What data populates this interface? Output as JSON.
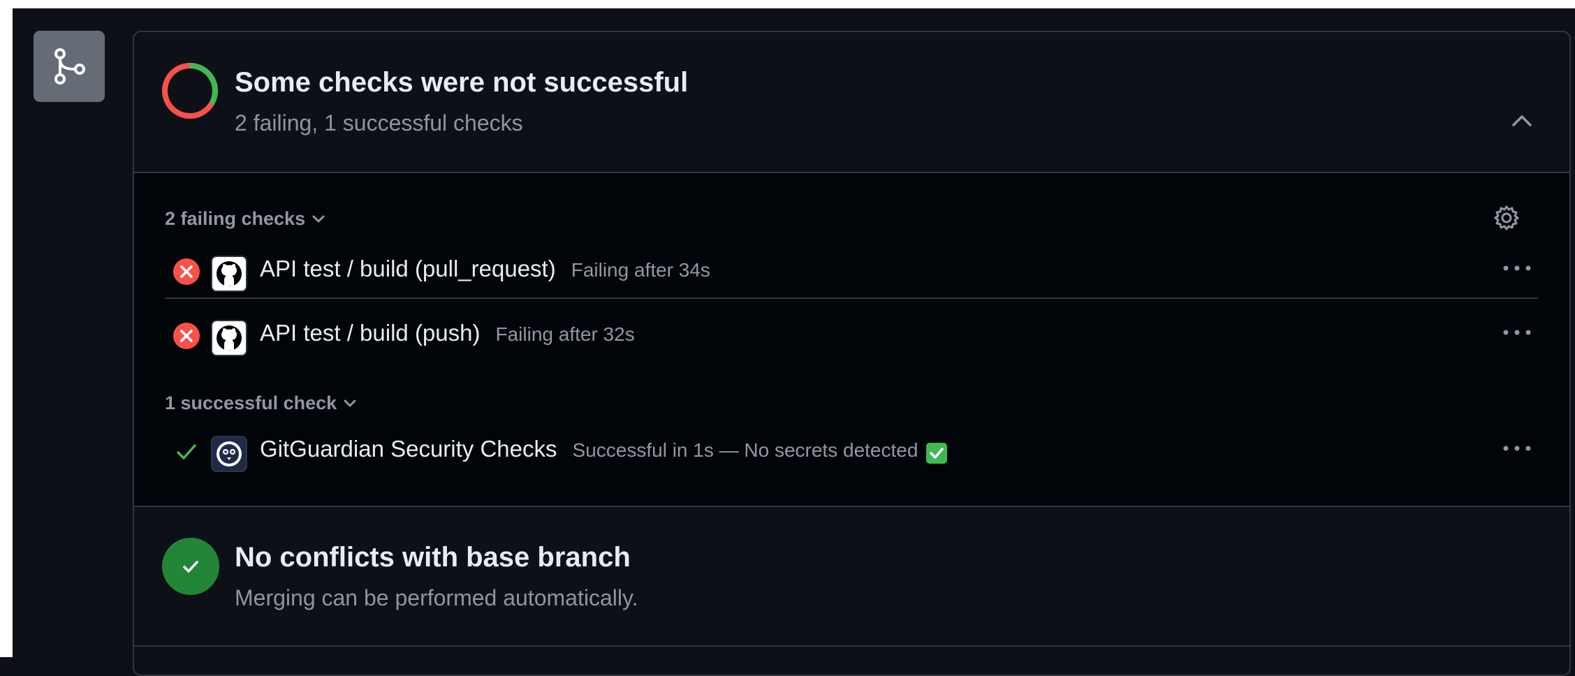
{
  "checks_summary": {
    "title": "Some checks were not successful",
    "subtitle": "2 failing, 1 successful checks",
    "failing_count": 2,
    "successful_count": 1,
    "colors": {
      "failing": "#f85149",
      "success": "#3fb950"
    }
  },
  "failing_group": {
    "label": "2 failing checks",
    "checks": [
      {
        "name": "API test / build (pull_request)",
        "detail": "Failing after 34s",
        "status": "failing",
        "app_icon": "github-icon"
      },
      {
        "name": "API test / build (push)",
        "detail": "Failing after 32s",
        "status": "failing",
        "app_icon": "github-icon"
      }
    ]
  },
  "success_group": {
    "label": "1 successful check",
    "checks": [
      {
        "name": "GitGuardian Security Checks",
        "detail": "Successful in 1s — No secrets detected",
        "status": "success",
        "app_icon": "gitguardian-icon"
      }
    ]
  },
  "conflicts": {
    "title": "No conflicts with base branch",
    "subtitle": "Merging can be performed automatically."
  },
  "icons": {
    "merge_badge": "git-merge-icon",
    "collapse": "chevron-up-icon",
    "settings": "gear-icon",
    "more": "kebab-horizontal-icon"
  }
}
